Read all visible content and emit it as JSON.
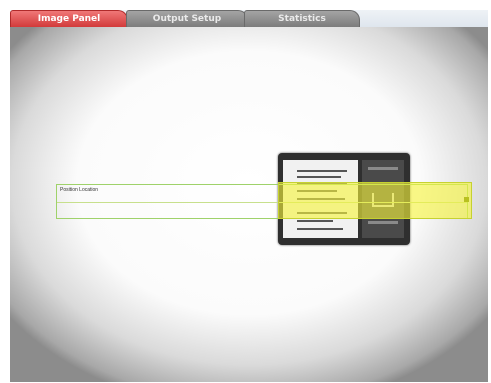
{
  "tabs": [
    {
      "label": "Image Panel",
      "active": true
    },
    {
      "label": "Output Setup",
      "active": false
    },
    {
      "label": "Statistics",
      "active": false
    }
  ],
  "image_panel": {
    "roi_label": "Position Location"
  },
  "colors": {
    "active_tab": "#d23a3a",
    "inactive_tab": "#8c8c8c",
    "roi_outline": "#9fd26a",
    "highlight": "#f6f43c"
  }
}
